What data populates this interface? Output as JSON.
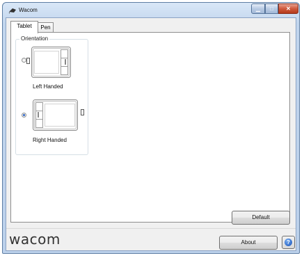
{
  "window": {
    "title": "Wacom",
    "minimize_glyph": "▁",
    "maximize_glyph": "□",
    "close_glyph": "✕"
  },
  "tabs": [
    {
      "label": "Tablet",
      "selected": true
    },
    {
      "label": "Pen",
      "selected": false
    }
  ],
  "orientation": {
    "group_label": "Orientation",
    "options": [
      {
        "label": "Left Handed",
        "selected": false
      },
      {
        "label": "Right Handed",
        "selected": true
      }
    ]
  },
  "buttons": {
    "default_label": "Default",
    "about_label": "About",
    "help_glyph": "?"
  },
  "brand": {
    "logo_text": "wacom"
  },
  "colors": {
    "accent": "#2b63c6",
    "close_red": "#c9462b"
  },
  "icons": [
    "wacom-app-icon",
    "help-icon",
    "minimize-icon",
    "maximize-icon",
    "close-icon"
  ]
}
